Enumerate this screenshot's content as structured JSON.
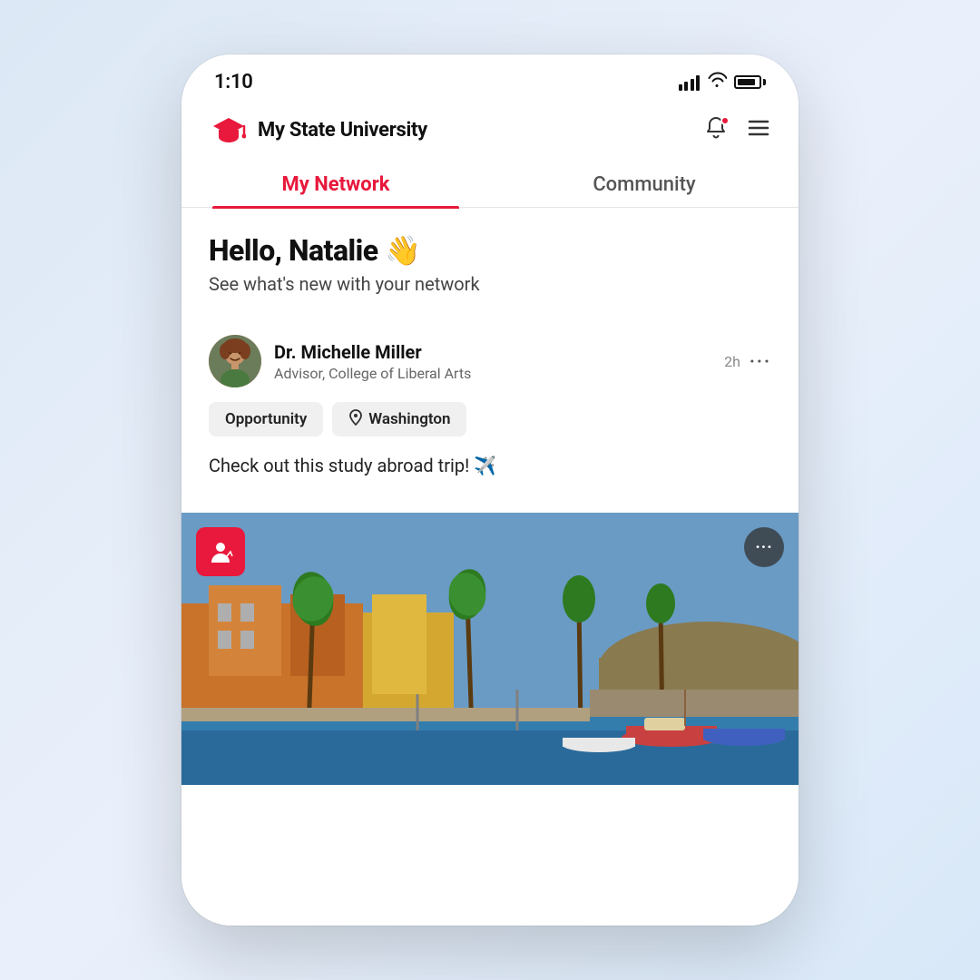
{
  "status": {
    "time": "1:10",
    "battery_level": 85
  },
  "header": {
    "app_name": "My State University",
    "grad_cap_alt": "graduation-cap"
  },
  "tabs": [
    {
      "id": "my-network",
      "label": "My Network",
      "active": true
    },
    {
      "id": "community",
      "label": "Community",
      "active": false
    }
  ],
  "greeting": {
    "title": "Hello, Natalie 👋",
    "subtitle": "See what's new with your network"
  },
  "post": {
    "author": {
      "name": "Dr. Michelle Miller",
      "role": "Advisor, College of Liberal Arts",
      "avatar_alt": "Dr. Michelle Miller avatar"
    },
    "time": "2h",
    "more_label": "···",
    "tags": [
      {
        "id": "opportunity",
        "label": "Opportunity",
        "has_icon": false
      },
      {
        "id": "washington",
        "label": "Washington",
        "has_icon": true
      }
    ],
    "text": "Check out this study abroad trip! ✈️",
    "image": {
      "alt": "Study abroad trip scenic waterfront",
      "overlay_icon": "map-pin-person-icon",
      "more_button_label": "···"
    }
  },
  "colors": {
    "brand_red": "#e8193c",
    "tab_active": "#e8193c",
    "tab_inactive": "#555555",
    "tag_bg": "#f0f0f0"
  }
}
